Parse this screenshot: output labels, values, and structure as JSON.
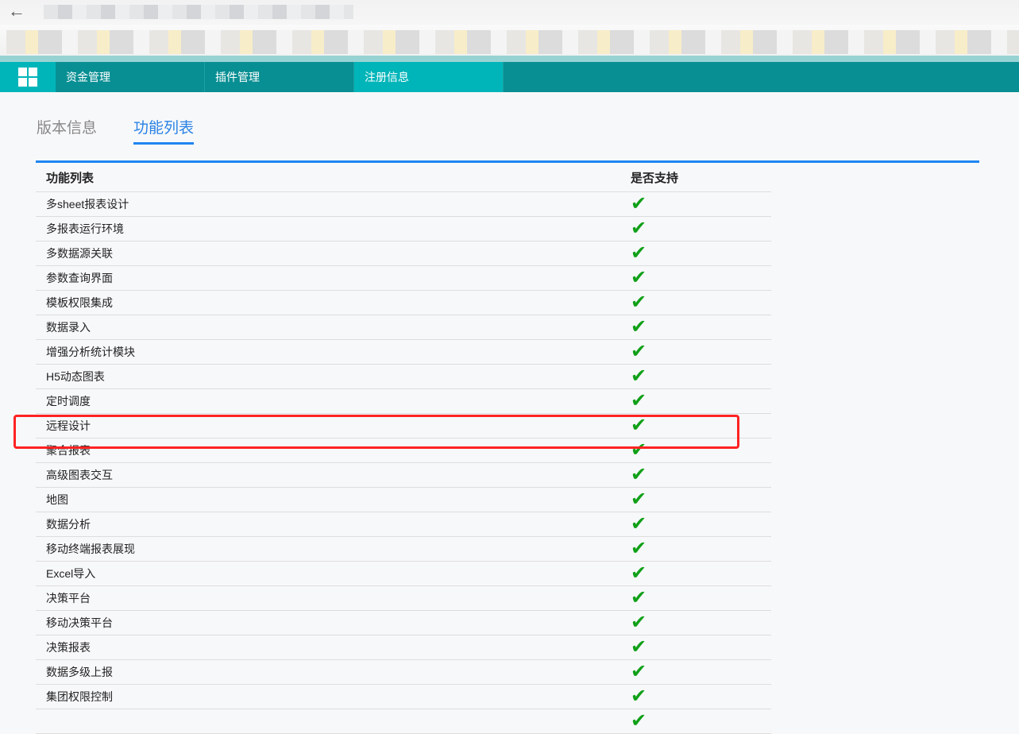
{
  "nav": {
    "items": [
      "资金管理",
      "插件管理",
      "注册信息"
    ],
    "active": 2
  },
  "tabs": [
    "版本信息",
    "功能列表"
  ],
  "table": {
    "headers": [
      "功能列表",
      "是否支持"
    ],
    "rows": [
      "多sheet报表设计",
      "多报表运行环境",
      "多数据源关联",
      "参数查询界面",
      "模板权限集成",
      "数据录入",
      "增强分析统计模块",
      "H5动态图表",
      "定时调度",
      "远程设计",
      "聚合报表",
      "高级图表交互",
      "地图",
      "数据分析",
      "移动终端报表展现",
      "Excel导入",
      "决策平台",
      "移动决策平台",
      "决策报表",
      "数据多级上报",
      "集团权限控制",
      ""
    ],
    "supported_symbol": "✔"
  },
  "highlight_row": "远程设计"
}
